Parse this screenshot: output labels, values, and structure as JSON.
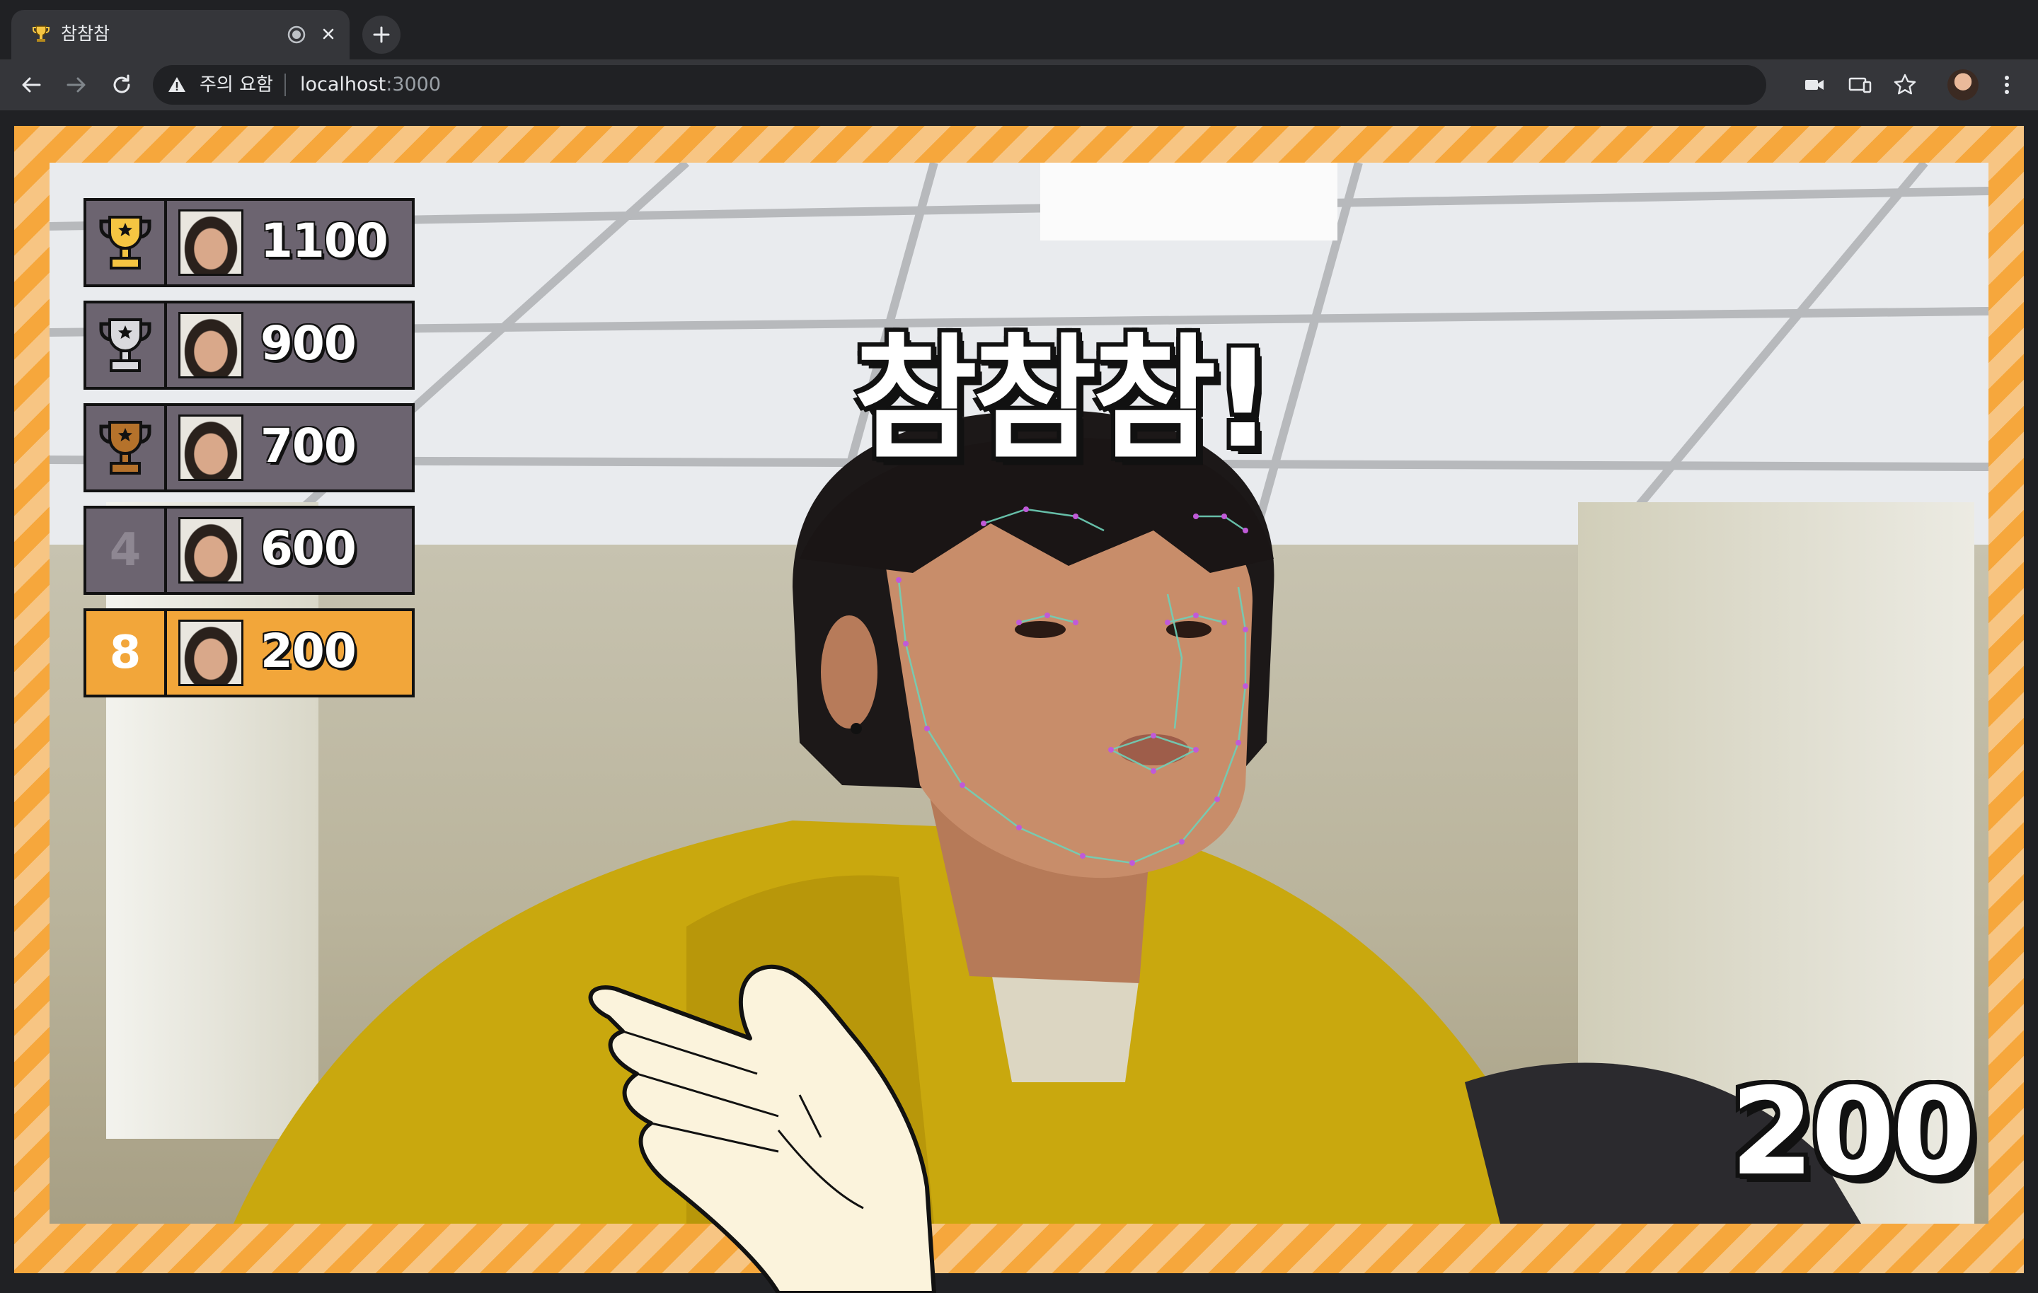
{
  "browser": {
    "tab_title": "참참참",
    "warning_text": "주의 요함",
    "url_host": "localhost",
    "url_port": ":3000"
  },
  "game": {
    "title": "참참참!",
    "current_score": "200",
    "leaderboard": [
      {
        "rank": "1",
        "rank_icon": "gold-trophy-icon",
        "score": "1100"
      },
      {
        "rank": "2",
        "rank_icon": "silver-trophy-icon",
        "score": "900"
      },
      {
        "rank": "3",
        "rank_icon": "bronze-trophy-icon",
        "score": "700"
      },
      {
        "rank": "4",
        "rank_label": "4",
        "score": "600"
      },
      {
        "rank": "8",
        "rank_label": "8",
        "score": "200",
        "is_me": true
      }
    ]
  },
  "colors": {
    "accent_orange": "#f2a63a",
    "row_gray": "#6c6470",
    "gold": "#f5c542",
    "silver": "#d9d9dd",
    "bronze": "#b5722b"
  }
}
